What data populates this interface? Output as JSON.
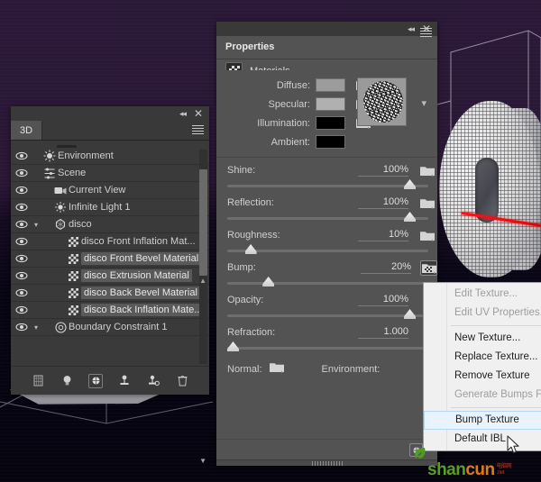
{
  "background": {
    "canvas_color": "#221231",
    "object_name": "3d-extruded-letter-mesh",
    "light_ray_color": "#ff1414"
  },
  "panel_3d": {
    "tab_label": "3D",
    "topbar": {
      "collapse_icon": "double-chevron-left-icon",
      "close_icon": "close-icon",
      "menu_icon": "hamburger-menu-icon"
    },
    "toolbar": [
      {
        "name": "scene-filter",
        "icon": "scene-icon",
        "active": true
      },
      {
        "name": "mesh-filter",
        "icon": "mesh-icon",
        "active": false
      },
      {
        "name": "materials-filter",
        "icon": "materials-icon",
        "active": false
      },
      {
        "name": "lights-filter",
        "icon": "light-bulb-icon",
        "active": false
      }
    ],
    "items": [
      {
        "label": "Environment",
        "icon": "environment-icon",
        "indent": 0,
        "twisty": "",
        "selected": false
      },
      {
        "label": "Scene",
        "icon": "scene-icon",
        "indent": 0,
        "twisty": "",
        "selected": false
      },
      {
        "label": "Current View",
        "icon": "camera-icon",
        "indent": 1,
        "twisty": "",
        "selected": false
      },
      {
        "label": "Infinite Light 1",
        "icon": "light-icon",
        "indent": 1,
        "twisty": "",
        "selected": false
      },
      {
        "label": "disco",
        "icon": "mesh-object-icon",
        "indent": 1,
        "twisty": "v",
        "selected": false
      },
      {
        "label": "disco Front Inflation Mat...",
        "icon": "material-icon",
        "indent": 2,
        "twisty": "",
        "selected": false
      },
      {
        "label": "disco Front Bevel Material",
        "icon": "material-icon",
        "indent": 2,
        "twisty": "",
        "selected": true
      },
      {
        "label": "disco Extrusion Material",
        "icon": "material-icon",
        "indent": 2,
        "twisty": "",
        "selected": true
      },
      {
        "label": "disco Back Bevel Material",
        "icon": "material-icon",
        "indent": 2,
        "twisty": "",
        "selected": true
      },
      {
        "label": "disco Back Inflation Mate...",
        "icon": "material-icon",
        "indent": 2,
        "twisty": "",
        "selected": true
      },
      {
        "label": "Boundary Constraint 1",
        "icon": "constraint-icon",
        "indent": 1,
        "twisty": "v",
        "selected": false
      }
    ],
    "bottom_toolbar": [
      {
        "name": "add-mesh-button",
        "icon": "mesh-icon"
      },
      {
        "name": "add-light-button",
        "icon": "light-bulb-icon"
      },
      {
        "name": "add-material-button",
        "icon": "sphere-icon"
      },
      {
        "name": "new-constraint-button",
        "icon": "constraint-icon"
      },
      {
        "name": "constraint-options-button",
        "icon": "constraint-gear-icon"
      },
      {
        "name": "delete-button",
        "icon": "trash-icon"
      }
    ]
  },
  "properties": {
    "topbar": {
      "collapse_icon": "double-chevron-left-icon",
      "close_icon": "close-icon",
      "menu_icon": "hamburger-menu-icon"
    },
    "tab_label": "Properties",
    "section_title": "Materials",
    "section_icon": "materials-icon",
    "colors": [
      {
        "label": "Diffuse:",
        "swatch": "#9c9c9c",
        "folder_icon": "texture-loaded-icon"
      },
      {
        "label": "Specular:",
        "swatch": "#b0b0b0",
        "folder_icon": "folder-icon"
      },
      {
        "label": "Illumination:",
        "swatch": "#000000",
        "folder_icon": "folder-icon"
      },
      {
        "label": "Ambient:",
        "swatch": "#000000",
        "folder_icon": ""
      }
    ],
    "preview": {
      "name": "material-preview-thumbnail",
      "chevron": "chevron-down-icon"
    },
    "sliders": [
      {
        "label": "Shine:",
        "value": "100%",
        "pct": 100,
        "folder_icon": "folder-icon",
        "active": false
      },
      {
        "label": "Reflection:",
        "value": "100%",
        "pct": 100,
        "folder_icon": "folder-icon",
        "active": false
      },
      {
        "label": "Roughness:",
        "value": "10%",
        "pct": 10,
        "folder_icon": "folder-icon",
        "active": false
      },
      {
        "label": "Bump:",
        "value": "20%",
        "pct": 20,
        "folder_icon": "texture-loaded-icon",
        "active": true
      },
      {
        "label": "Opacity:",
        "value": "100%",
        "pct": 100,
        "folder_icon": "",
        "active": false
      },
      {
        "label": "Refraction:",
        "value": "1.000",
        "pct": 0,
        "folder_icon": "",
        "active": false
      }
    ],
    "normal_label": "Normal:",
    "normal_icon": "folder-icon",
    "environment_label": "Environment:",
    "footer_button": "new-material-button"
  },
  "context_menu": {
    "items": [
      {
        "label": "Edit Texture...",
        "state": "disabled"
      },
      {
        "label": "Edit UV Properties...",
        "state": "disabled"
      },
      {
        "separator": true
      },
      {
        "label": "New Texture...",
        "state": "normal"
      },
      {
        "label": "Replace Texture...",
        "state": "normal"
      },
      {
        "label": "Remove Texture",
        "state": "normal"
      },
      {
        "label": "Generate Bumps From Diffuse",
        "state": "disabled"
      },
      {
        "separator": true
      },
      {
        "label": "Bump Texture",
        "state": "highlighted"
      },
      {
        "label": "Default IBL",
        "state": "normal"
      }
    ]
  },
  "watermark": {
    "primary": "shan",
    "secondary": "cun",
    "sub_top": "电脑网",
    "sub_bottom": ".net"
  },
  "cursor": {
    "name": "mouse-pointer-icon"
  }
}
